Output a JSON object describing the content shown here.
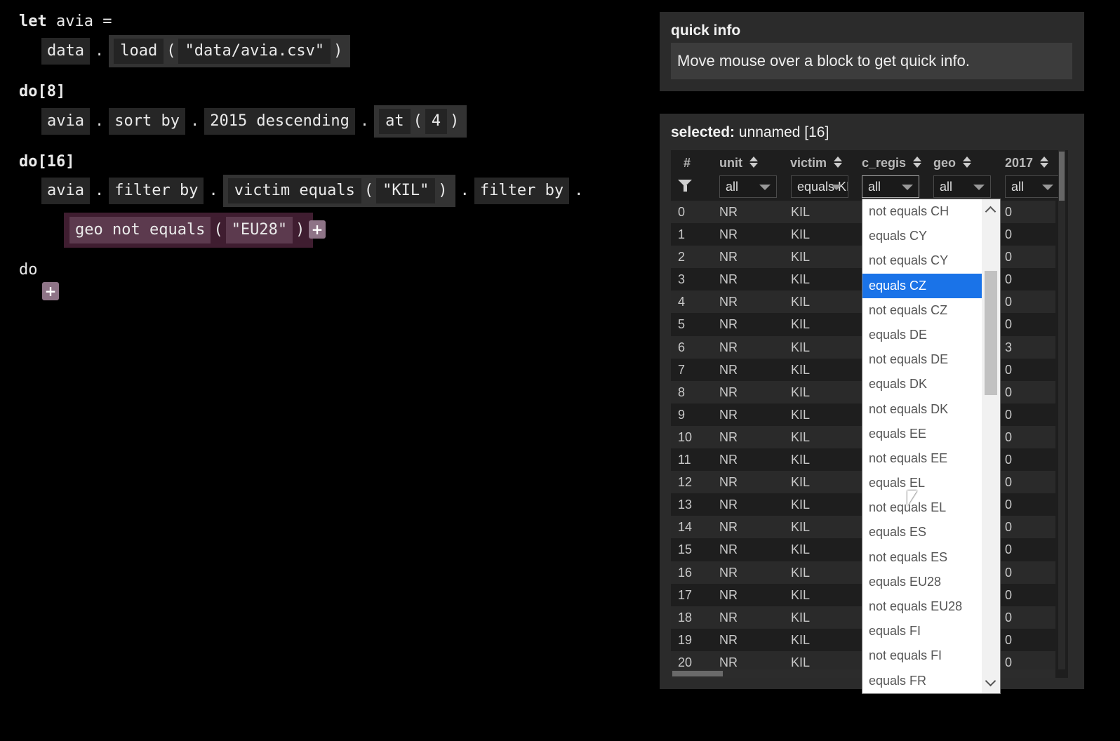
{
  "editor": {
    "let_keyword": "let",
    "var_name": "avia",
    "equals": "=",
    "line1": {
      "data": "data",
      "dot": ".",
      "load": "load",
      "open": "(",
      "arg": "\"data/avia.csv\"",
      "close": ")"
    },
    "do8": {
      "keyword": "do",
      "count": "[8]"
    },
    "line2": {
      "avia": "avia",
      "dot": ".",
      "sort": "sort by",
      "sortarg": "2015 descending",
      "at": "at",
      "open": "(",
      "num": "4",
      "close": ")"
    },
    "do16": {
      "keyword": "do",
      "count": "[16]"
    },
    "line3": {
      "avia": "avia",
      "dot": ".",
      "filter": "filter by",
      "victim": "victim equals",
      "open": "(",
      "arg": "\"KIL\"",
      "close": ")",
      "filter2": "filter by"
    },
    "line4": {
      "geo": "geo not equals",
      "open": "(",
      "arg": "\"EU28\"",
      "close": ")"
    },
    "plus": "+",
    "do_empty": "do"
  },
  "quick_info": {
    "title": "quick info",
    "message": "Move mouse over a block to get quick info."
  },
  "selected": {
    "label": "selected:",
    "name": "unnamed [16]"
  },
  "table": {
    "columns": [
      "#",
      "unit",
      "victim",
      "c_regis",
      "geo",
      "2017"
    ],
    "filters": [
      "",
      "all",
      "equals KI",
      "all",
      "all",
      "all"
    ],
    "rows": [
      [
        "0",
        "NR",
        "KIL",
        "0"
      ],
      [
        "1",
        "NR",
        "KIL",
        "0"
      ],
      [
        "2",
        "NR",
        "KIL",
        "0"
      ],
      [
        "3",
        "NR",
        "KIL",
        "0"
      ],
      [
        "4",
        "NR",
        "KIL",
        "0"
      ],
      [
        "5",
        "NR",
        "KIL",
        "0"
      ],
      [
        "6",
        "NR",
        "KIL",
        "3"
      ],
      [
        "7",
        "NR",
        "KIL",
        "0"
      ],
      [
        "8",
        "NR",
        "KIL",
        "0"
      ],
      [
        "9",
        "NR",
        "KIL",
        "0"
      ],
      [
        "10",
        "NR",
        "KIL",
        "0"
      ],
      [
        "11",
        "NR",
        "KIL",
        "0"
      ],
      [
        "12",
        "NR",
        "KIL",
        "0"
      ],
      [
        "13",
        "NR",
        "KIL",
        "0"
      ],
      [
        "14",
        "NR",
        "KIL",
        "0"
      ],
      [
        "15",
        "NR",
        "KIL",
        "0"
      ],
      [
        "16",
        "NR",
        "KIL",
        "0"
      ],
      [
        "17",
        "NR",
        "KIL",
        "0"
      ],
      [
        "18",
        "NR",
        "KIL",
        "0"
      ],
      [
        "19",
        "NR",
        "KIL",
        "0"
      ],
      [
        "20",
        "NR",
        "KIL",
        "0"
      ]
    ]
  },
  "dropdown": {
    "options": [
      "not equals CH",
      "equals CY",
      "not equals CY",
      "equals CZ",
      "not equals CZ",
      "equals DE",
      "not equals DE",
      "equals DK",
      "not equals DK",
      "equals EE",
      "not equals EE",
      "equals EL",
      "not equals EL",
      "equals ES",
      "not equals ES",
      "equals EU28",
      "not equals EU28",
      "equals FI",
      "not equals FI",
      "equals FR"
    ],
    "selected_index": 3
  },
  "colors": {
    "background": "#000000",
    "panel": "#2b2b2b",
    "highlight_pink": "#3f1d30",
    "selection_blue": "#1a73e8"
  }
}
